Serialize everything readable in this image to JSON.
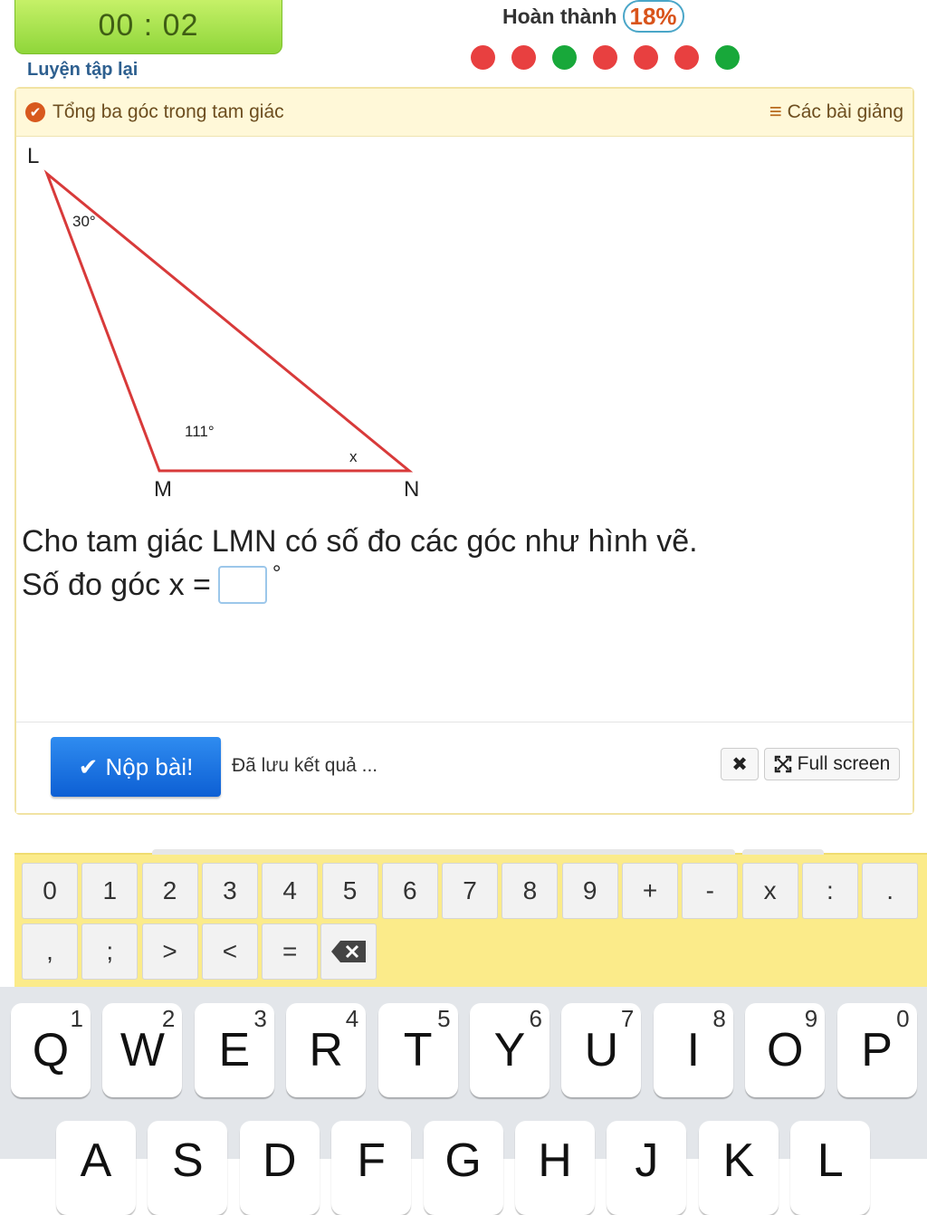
{
  "header": {
    "timer": "00 : 02",
    "retry_label": "Luyện tập lại",
    "progress_label": "Hoàn thành",
    "progress_percent": "18%",
    "progress_value": 0.18,
    "answer_dots": [
      "#e84040",
      "#e84040",
      "#18a83a",
      "#e84040",
      "#e84040",
      "#e84040",
      "#18a83a"
    ]
  },
  "card": {
    "lesson_title": "Tổng ba góc trong tam giác",
    "lessons_link": "Các bài giảng",
    "figure": {
      "vertex_L": "L",
      "vertex_M": "M",
      "vertex_N": "N",
      "angle_L": "30°",
      "angle_M": "111°",
      "angle_N": "x"
    },
    "question_line1": "Cho tam giác LMN có số đo các góc như hình vẽ.",
    "question_line2": "Số đo góc x =",
    "degree_symbol": "°",
    "answer_value": ""
  },
  "footer": {
    "submit_label": "Nộp bài!",
    "saved_text": "Đã lưu kết quả ...",
    "close_symbol": "✖",
    "fullscreen_label": "Full screen"
  },
  "math_keypad": {
    "row1": [
      "0",
      "1",
      "2",
      "3",
      "4",
      "5",
      "6",
      "7",
      "8",
      "9",
      "+",
      "-",
      "x",
      ":",
      "."
    ],
    "row2": [
      ",",
      ";",
      ">",
      "<",
      "="
    ]
  },
  "keyboard": {
    "row1": [
      {
        "letter": "Q",
        "hint": "1"
      },
      {
        "letter": "W",
        "hint": "2"
      },
      {
        "letter": "E",
        "hint": "3"
      },
      {
        "letter": "R",
        "hint": "4"
      },
      {
        "letter": "T",
        "hint": "5"
      },
      {
        "letter": "Y",
        "hint": "6"
      },
      {
        "letter": "U",
        "hint": "7"
      },
      {
        "letter": "I",
        "hint": "8"
      },
      {
        "letter": "O",
        "hint": "9"
      },
      {
        "letter": "P",
        "hint": "0"
      }
    ],
    "row2": [
      "A",
      "S",
      "D",
      "F",
      "G",
      "H",
      "J",
      "K",
      "L"
    ]
  }
}
